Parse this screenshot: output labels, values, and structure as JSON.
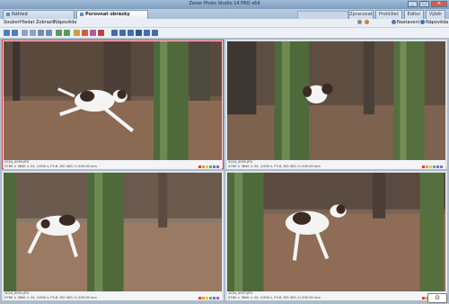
{
  "window": {
    "title": "Zoner Photo Studio 14 PRO x64",
    "controls": [
      "_",
      "□",
      "✕"
    ]
  },
  "tabs": [
    {
      "label": "Náhled",
      "active": false
    },
    {
      "label": "Porovnat obrázky",
      "active": true
    }
  ],
  "right_tabs": [
    {
      "label": "Zpracovat"
    },
    {
      "label": "Prohlížeč"
    },
    {
      "label": "Editor"
    },
    {
      "label": "Výběr"
    }
  ],
  "menu": [
    "Soubor",
    "Hledat",
    "Zobrazit",
    "Nápověda"
  ],
  "right_menu": {
    "network": "Nastavení",
    "help": "Nápověda"
  },
  "toolbar_icons": [
    "back-icon",
    "forward-icon",
    "zoom-in-icon",
    "zoom-out-icon",
    "fit-icon",
    "actual-size-icon",
    "rotate-left-icon",
    "rotate-right-icon",
    "info-icon",
    "flag-icon",
    "label-icon",
    "delete-icon",
    "grid-1-icon",
    "grid-2-icon",
    "grid-3-icon",
    "grid-4-icon",
    "grid-5-icon",
    "grid-6-icon"
  ],
  "photos": [
    {
      "file": "2024_0090.JPG",
      "exif": "5760 × 3840 × 24, 1/500 s, F5.6, ISO 400, f=200.00 mm",
      "selected": true
    },
    {
      "file": "2024_0095.JPG",
      "exif": "5760 × 3840 × 24, 1/500 s, F5.6, ISO 400, f=200.00 mm",
      "selected": false
    },
    {
      "file": "2024_0091.JPG",
      "exif": "5760 × 3840 × 24, 1/500 s, F5.6, ISO 400, f=200.00 mm",
      "selected": false
    },
    {
      "file": "2024_0097.JPG",
      "exif": "5760 × 3840 × 24, 1/500 s, F5.6, ISO 400, f=200.00 mm",
      "selected": false
    }
  ],
  "label_colors": [
    "#e04040",
    "#e8a030",
    "#e0d040",
    "#60b060",
    "#5080d0",
    "#a060c0"
  ],
  "colors": {
    "accent": "#e04040",
    "ground": "#7a5a45",
    "trunk": "#4e6a3a",
    "dog_white": "#f4f4f4",
    "dog_patch": "#3b2a22"
  }
}
